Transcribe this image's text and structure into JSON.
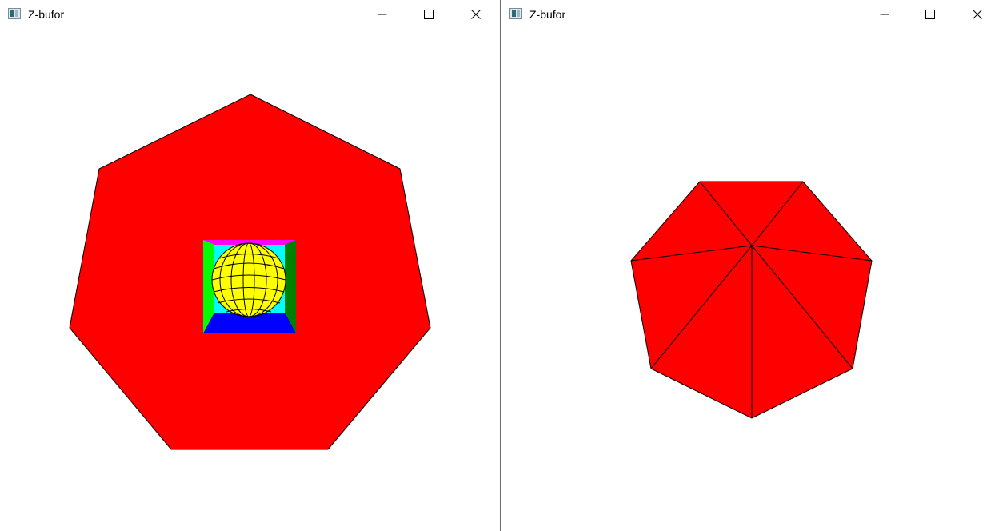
{
  "windows": [
    {
      "title": "Z-bufor",
      "icon": "app-window-icon",
      "controls": [
        "minimize-icon",
        "maximize-icon",
        "close-icon"
      ]
    },
    {
      "title": "Z-bufor",
      "icon": "app-window-icon",
      "controls": [
        "minimize-icon",
        "maximize-icon",
        "close-icon"
      ]
    }
  ],
  "scene": {
    "heptagon_color": "#ff0000",
    "sphere_color": "#ffff00",
    "box_colors": {
      "back": "#00ffff",
      "top": "#ff00ff",
      "left": "#00ff00",
      "right": "#008000",
      "bottom": "#0000ff"
    },
    "edge_color": "#000000"
  }
}
